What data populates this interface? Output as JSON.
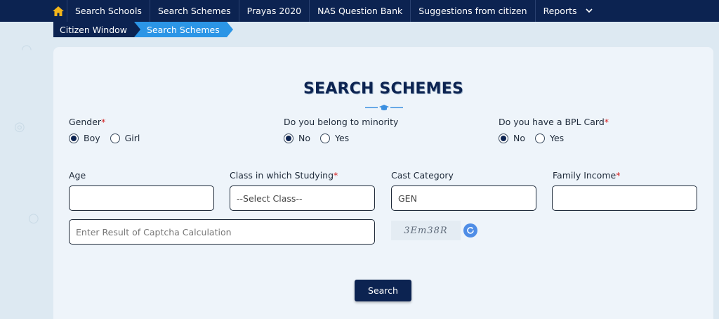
{
  "nav": {
    "items": [
      "Search Schools",
      "Search Schemes",
      "Prayas 2020",
      "NAS Question Bank",
      "Suggestions from citizen",
      "Reports"
    ],
    "home_icon": "home-icon",
    "dropdown_icon": "chevron-down-icon"
  },
  "breadcrumb": {
    "parent": "Citizen Window",
    "current": "Search Schemes"
  },
  "form": {
    "title": "SEARCH SCHEMES",
    "gender": {
      "label": "Gender",
      "options": [
        "Boy",
        "Girl"
      ],
      "selected": "Boy"
    },
    "minority": {
      "label": "Do you belong to minority",
      "options": [
        "No",
        "Yes"
      ],
      "selected": "No"
    },
    "bpl": {
      "label": "Do you have a BPL Card",
      "options": [
        "No",
        "Yes"
      ],
      "selected": "No"
    },
    "age": {
      "label": "Age",
      "value": ""
    },
    "class": {
      "label": "Class in which Studying",
      "value": "--Select Class--"
    },
    "cast": {
      "label": "Cast Category",
      "value": "GEN"
    },
    "income": {
      "label": "Family Income",
      "value": ""
    },
    "captcha": {
      "placeholder": "Enter Result of Captcha Calculation",
      "image_text": "3Em38R"
    },
    "search_label": "Search"
  },
  "colors": {
    "navy": "#0c2351",
    "accent_blue": "#2b95e6",
    "required": "#d42020"
  }
}
